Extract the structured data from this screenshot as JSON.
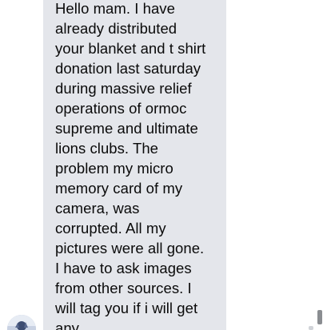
{
  "conversation": {
    "message": {
      "text": "Hello mam. I have\nalready distributed\nyour blanket and t shirt\ndonation last saturday\nduring massive relief\noperations of ormoc\nsupreme and ultimate\nlions clubs. The\nproblem my micro\nmemory card of my\ncamera, was\ncorrupted. All my\npictures were all gone.\nI have to ask images\nfrom other sources. I\nwill tag you if i will get\nany."
    },
    "sender_avatar_icon": "user-avatar-icon"
  },
  "colors": {
    "bubble_background": "#e4e6eb",
    "text": "#0a0a0a",
    "page_background": "#ffffff",
    "scrollbar": "#8a8d91"
  }
}
